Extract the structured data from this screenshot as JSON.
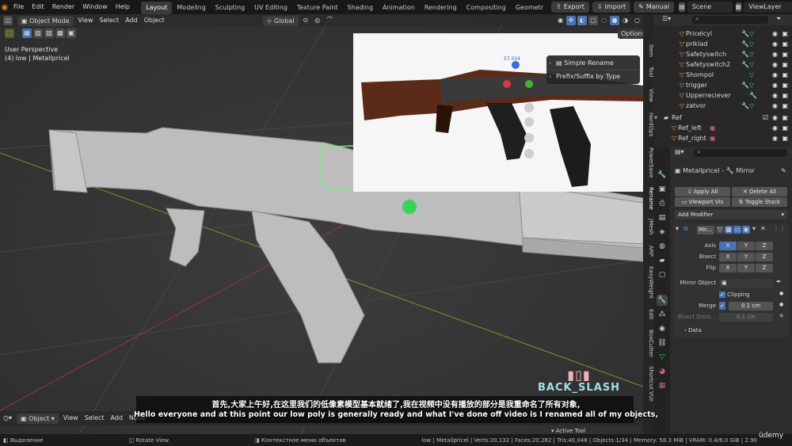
{
  "menubar": {
    "menus": [
      "File",
      "Edit",
      "Render",
      "Window",
      "Help"
    ],
    "workspaces": [
      "Layout",
      "Modeling",
      "Sculpting",
      "UV Editing",
      "Texture Paint",
      "Shading",
      "Animation",
      "Rendering",
      "Compositing",
      "Geometr"
    ],
    "active_workspace": "Layout",
    "export_label": "Export",
    "import_label": "Import",
    "manual_label": "Manual",
    "scene_label": "Scene",
    "viewlayer_label": "ViewLayer"
  },
  "viewport": {
    "mode": "Object Mode",
    "menus": [
      "View",
      "Select",
      "Add",
      "Object"
    ],
    "transform_orientation": "Global",
    "options_label": "Options",
    "info_perspective": "User Perspective",
    "info_object": "(4) low | Metallpricel",
    "ref_number": "57.554"
  },
  "addon_popup": {
    "items": [
      "Simple Rename",
      "Prefix/Suffix by Type"
    ]
  },
  "n_panel_tabs": [
    "Item",
    "Tool",
    "View",
    "HardOps",
    "PowerSave",
    "Rename",
    "JMesh",
    "ARP",
    "EasyWeight",
    "Edit",
    "BoxCutter",
    "Shortcut VUr"
  ],
  "outliner": {
    "search_placeholder": "",
    "rows": [
      {
        "name": "Pricelcyl"
      },
      {
        "name": "priklad"
      },
      {
        "name": "Safetyswitch"
      },
      {
        "name": "Safetyswitch2"
      },
      {
        "name": "Shompol"
      },
      {
        "name": "trigger"
      },
      {
        "name": "Upperreciever"
      },
      {
        "name": "zatvor"
      }
    ],
    "collection": "Ref",
    "ref_rows": [
      {
        "name": "Ref_left"
      },
      {
        "name": "Ref_right"
      }
    ]
  },
  "properties": {
    "object_name": "Metallpricel",
    "modifier_context": "Mirror",
    "apply_all": "Apply All",
    "delete_all": "Delete All",
    "viewport_vis": "Viewport Vis",
    "toggle_stack": "Toggle Stack",
    "add_modifier": "Add Modifier",
    "modifier_name": "Mir...",
    "axis_label": "Axis",
    "bisect_label": "Bisect",
    "flip_label": "Flip",
    "axes": [
      "X",
      "Y",
      "Z"
    ],
    "mirror_object_label": "Mirror Object",
    "clipping_label": "Clipping",
    "merge_label": "Merge",
    "merge_value": "0.1 cm",
    "bisect_distance_label": "Bisect Dista...",
    "bisect_distance_value": "0.1 cm",
    "data_label": "Data"
  },
  "timeline": {
    "mode": "Object",
    "menus": [
      "View",
      "Select",
      "Add",
      "Node"
    ],
    "active_tool": "Active Tool"
  },
  "statusbar": {
    "left": [
      "Выделение",
      "Rotate View",
      "Контекстное меню объектов"
    ],
    "right": "low | Metallpricel | Verts:20,132 | Faces:20,282 | Tris:40,048 | Objects:1/34 | Memory: 58.3 MiB | VRAM: 0.4/6.0 GiB | 2.90"
  },
  "overlay": {
    "subtitle_cn": "首先,大家上午好,在这里我们的低像素模型基本就绪了,我在视频中没有播放的部分是我重命名了所有对象,",
    "subtitle_en": "Hello everyone and at this point our low poly is generally ready and what I've done off video is I renamed all of my objects,",
    "watermark": "BACK_SLASH",
    "brand": "ūdemy"
  },
  "colors": {
    "accent_blue": "#4772b3",
    "selection_green": "#7ee87e",
    "cursor_green": "#39d353",
    "orange": "#e8a049"
  }
}
